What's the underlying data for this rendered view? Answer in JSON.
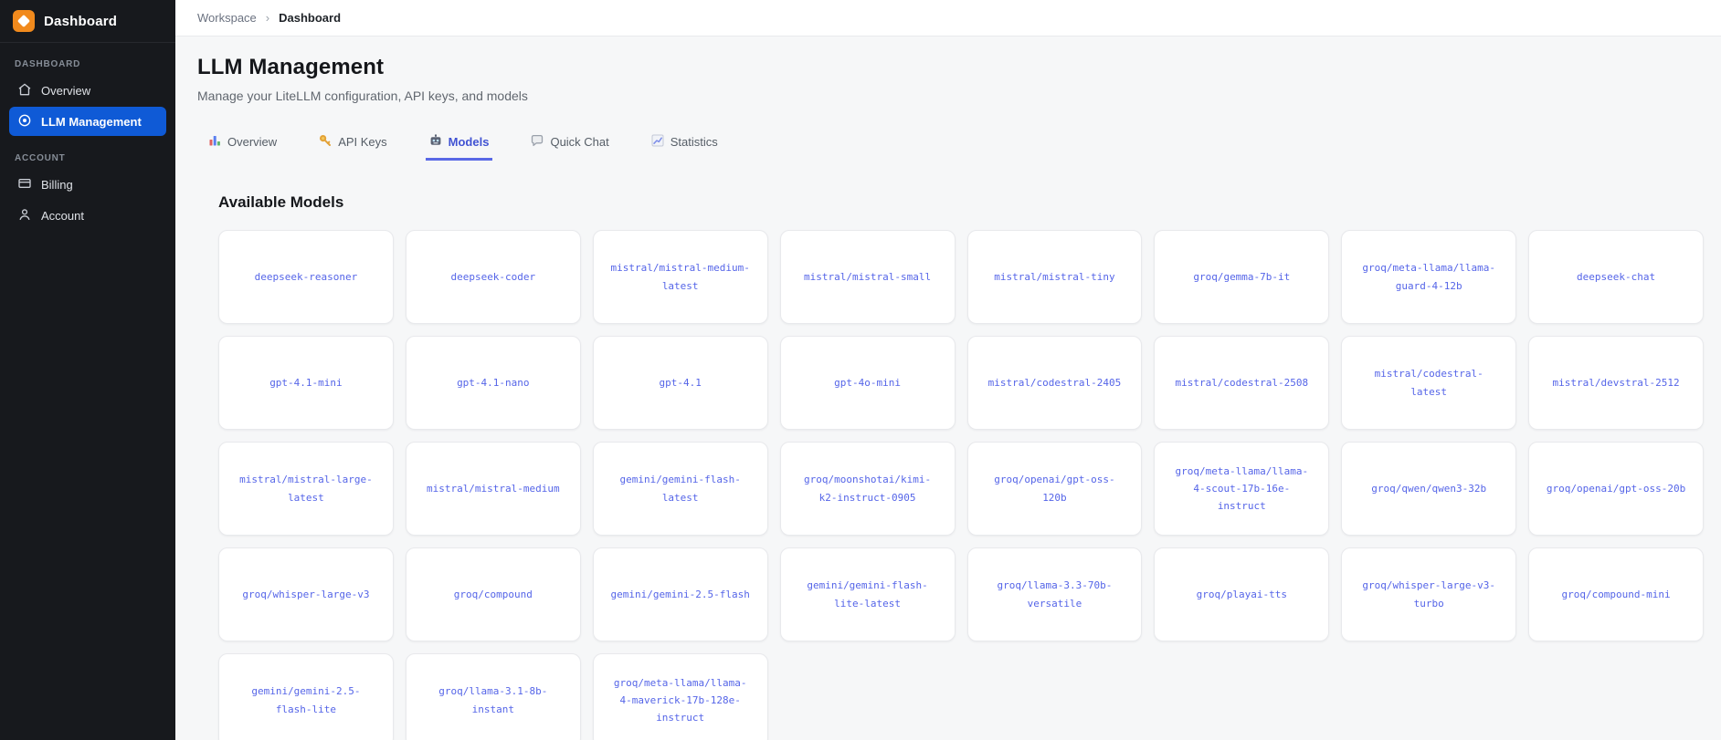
{
  "sidebar": {
    "logo_title": "Dashboard",
    "sections": [
      {
        "label": "DASHBOARD",
        "items": [
          {
            "label": "Overview",
            "icon": "home-icon",
            "active": false
          },
          {
            "label": "LLM Management",
            "icon": "target-icon",
            "active": true
          }
        ]
      },
      {
        "label": "ACCOUNT",
        "items": [
          {
            "label": "Billing",
            "icon": "credit-card-icon",
            "active": false
          },
          {
            "label": "Account",
            "icon": "user-icon",
            "active": false
          }
        ]
      }
    ]
  },
  "breadcrumb": {
    "items": [
      "Workspace",
      "Dashboard"
    ],
    "separator": "›"
  },
  "header": {
    "title": "LLM Management",
    "subtitle": "Manage your LiteLLM configuration, API keys, and models"
  },
  "tabs": [
    {
      "label": "Overview",
      "icon": "bar-chart-icon",
      "active": false
    },
    {
      "label": "API Keys",
      "icon": "key-icon",
      "active": false
    },
    {
      "label": "Models",
      "icon": "robot-icon",
      "active": true
    },
    {
      "label": "Quick Chat",
      "icon": "chat-bubble-icon",
      "active": false
    },
    {
      "label": "Statistics",
      "icon": "line-chart-icon",
      "active": false
    }
  ],
  "models_section": {
    "heading": "Available Models",
    "models": [
      "deepseek-reasoner",
      "deepseek-coder",
      "mistral/mistral-medium-latest",
      "mistral/mistral-small",
      "mistral/mistral-tiny",
      "groq/gemma-7b-it",
      "groq/meta-llama/llama-guard-4-12b",
      "deepseek-chat",
      "gpt-4.1-mini",
      "gpt-4.1-nano",
      "gpt-4.1",
      "gpt-4o-mini",
      "mistral/codestral-2405",
      "mistral/codestral-2508",
      "mistral/codestral-latest",
      "mistral/devstral-2512",
      "mistral/mistral-large-latest",
      "mistral/mistral-medium",
      "gemini/gemini-flash-latest",
      "groq/moonshotai/kimi-k2-instruct-0905",
      "groq/openai/gpt-oss-120b",
      "groq/meta-llama/llama-4-scout-17b-16e-instruct",
      "groq/qwen/qwen3-32b",
      "groq/openai/gpt-oss-20b",
      "groq/whisper-large-v3",
      "groq/compound",
      "gemini/gemini-2.5-flash",
      "gemini/gemini-flash-lite-latest",
      "groq/llama-3.3-70b-versatile",
      "groq/playai-tts",
      "groq/whisper-large-v3-turbo",
      "groq/compound-mini",
      "gemini/gemini-2.5-flash-lite",
      "groq/llama-3.1-8b-instant",
      "groq/meta-llama/llama-4-maverick-17b-128e-instruct"
    ]
  },
  "colors": {
    "sidebar_bg": "#17191d",
    "active_item_blue": "#0f5ad6",
    "logo_orange": "#f18a1d",
    "tab_active_blue": "#4153d3",
    "model_text_indigo": "#5565e8",
    "page_bg": "#f6f7f8"
  }
}
